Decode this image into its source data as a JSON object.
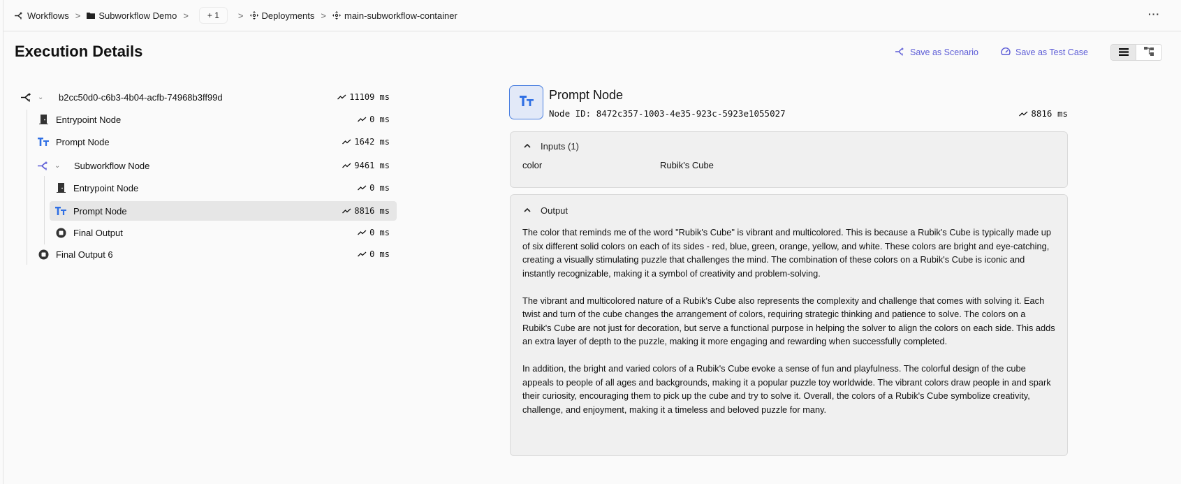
{
  "breadcrumb": {
    "items": [
      {
        "label": "Workflows",
        "icon": "workflow-icon"
      },
      {
        "label": "Subworkflow Demo",
        "icon": "folder-icon"
      },
      {
        "label": "+ 1",
        "icon": null
      },
      {
        "label": "Deployments",
        "icon": "deployment-icon"
      },
      {
        "label": "main-subworkflow-container",
        "icon": "deployment-icon"
      }
    ],
    "separator": ">",
    "more_label": "···"
  },
  "header": {
    "title": "Execution Details",
    "actions": {
      "save_scenario": "Save as Scenario",
      "save_test_case": "Save as Test Case"
    },
    "view_modes": [
      "list",
      "graph"
    ],
    "active_view": "list",
    "accent_color": "#5b5bd6"
  },
  "tree": {
    "rows": [
      {
        "label": "b2cc50d0-c6b3-4b04-acfb-74968b3ff99d",
        "duration": "11109 ms",
        "icon": "workflow-icon",
        "expandable": true,
        "depth": 0
      },
      {
        "label": "Entrypoint Node",
        "duration": "0 ms",
        "icon": "entrypoint-door-icon",
        "depth": 1
      },
      {
        "label": "Prompt Node",
        "duration": "1642 ms",
        "icon": "prompt-text-icon",
        "depth": 1
      },
      {
        "label": "Subworkflow Node",
        "duration": "9461 ms",
        "icon": "subworkflow-icon",
        "expandable": true,
        "depth": 1
      },
      {
        "label": "Entrypoint Node",
        "duration": "0 ms",
        "icon": "entrypoint-door-icon",
        "depth": 2
      },
      {
        "label": "Prompt Node",
        "duration": "8816 ms",
        "icon": "prompt-text-icon",
        "depth": 2,
        "selected": true
      },
      {
        "label": "Final Output",
        "duration": "0 ms",
        "icon": "final-output-icon",
        "depth": 2
      },
      {
        "label": "Final Output 6",
        "duration": "0 ms",
        "icon": "final-output-icon",
        "depth": 1
      }
    ]
  },
  "detail": {
    "title": "Prompt Node",
    "node_id": "Node ID: 8472c357-1003-4e35-923c-5923e1055027",
    "duration": "8816 ms",
    "inputs": {
      "header": "Inputs (1)",
      "items": [
        {
          "key": "color",
          "value": "Rubik's Cube"
        }
      ]
    },
    "output": {
      "header": "Output",
      "paragraphs": [
        "The color that reminds me of the word \"Rubik's Cube\" is vibrant and multicolored. This is because a Rubik's Cube is typically made up of six different solid colors on each of its sides - red, blue, green, orange, yellow, and white. These colors are bright and eye-catching, creating a visually stimulating puzzle that challenges the mind. The combination of these colors on a Rubik's Cube is iconic and instantly recognizable, making it a symbol of creativity and problem-solving.",
        "The vibrant and multicolored nature of a Rubik's Cube also represents the complexity and challenge that comes with solving it. Each twist and turn of the cube changes the arrangement of colors, requiring strategic thinking and patience to solve. The colors on a Rubik's Cube are not just for decoration, but serve a functional purpose in helping the solver to align the colors on each side. This adds an extra layer of depth to the puzzle, making it more engaging and rewarding when successfully completed.",
        "In addition, the bright and varied colors of a Rubik's Cube evoke a sense of fun and playfulness. The colorful design of the cube appeals to people of all ages and backgrounds, making it a popular puzzle toy worldwide. The vibrant colors draw people in and spark their curiosity, encouraging them to pick up the cube and try to solve it. Overall, the colors of a Rubik's Cube symbolize creativity, challenge, and enjoyment, making it a timeless and beloved puzzle for many."
      ]
    }
  }
}
